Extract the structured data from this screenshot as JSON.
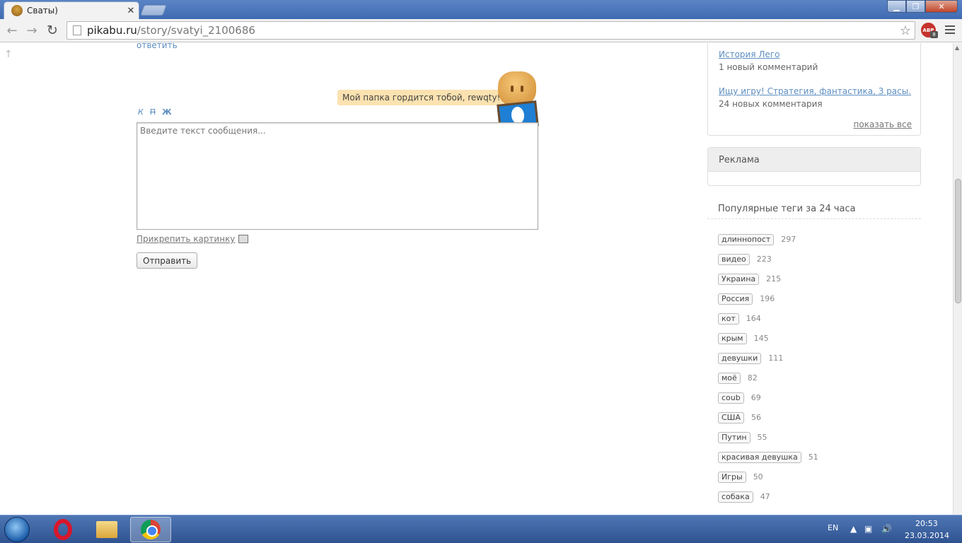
{
  "browser": {
    "tab_title": "Сваты)",
    "tab_close": "✕",
    "url_host": "pikabu.ru",
    "url_path": "/story/svatyi_2100686",
    "abp_label": "ABP",
    "abp_count": "8"
  },
  "comment": {
    "reply_link": "ответить",
    "speech": "Мой папка гордится тобой, rewqty!",
    "format_italic": "К",
    "format_strike": "П",
    "format_bold": "Ж",
    "placeholder": "Введите текст сообщения...",
    "attach_label": "Прикрепить картинку",
    "send_label": "Отправить"
  },
  "sidebar": {
    "stories": [
      {
        "title": "История Лего",
        "count": "1 новый комментарий"
      },
      {
        "title": "Ищу игру! Стратегия, фантастика, 3 расы.",
        "count": "24 новых комментария"
      }
    ],
    "show_all": "показать все",
    "ad_title": "Реклама",
    "tags_title": "Популярные теги за 24 часа",
    "tags": [
      {
        "name": "длиннопост",
        "count": "297"
      },
      {
        "name": "видео",
        "count": "223"
      },
      {
        "name": "Украина",
        "count": "215"
      },
      {
        "name": "Россия",
        "count": "196"
      },
      {
        "name": "кот",
        "count": "164"
      },
      {
        "name": "крым",
        "count": "145"
      },
      {
        "name": "девушки",
        "count": "111"
      },
      {
        "name": "моё",
        "count": "82"
      },
      {
        "name": "coub",
        "count": "69"
      },
      {
        "name": "США",
        "count": "56"
      },
      {
        "name": "Путин",
        "count": "55"
      },
      {
        "name": "красивая девушка",
        "count": "51"
      },
      {
        "name": "Игры",
        "count": "50"
      },
      {
        "name": "собака",
        "count": "47"
      }
    ]
  },
  "taskbar": {
    "lang": "EN",
    "time": "20:53",
    "date": "23.03.2014"
  },
  "icons": {
    "back": "arrow-left-icon",
    "forward": "arrow-right-icon",
    "reload": "reload-icon",
    "star": "star-icon",
    "menu": "menu-icon"
  }
}
